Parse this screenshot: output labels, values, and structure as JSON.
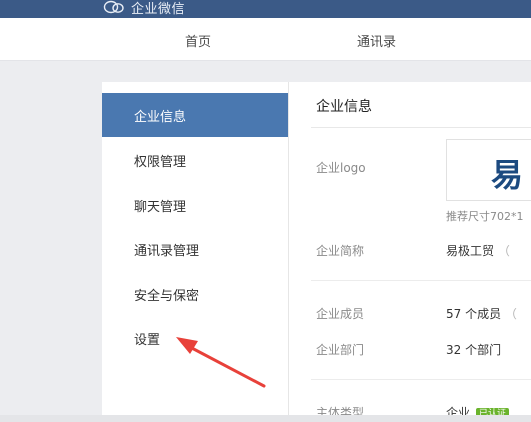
{
  "app": {
    "brand": "企业微信"
  },
  "nav": {
    "home": "首页",
    "contacts": "通讯录"
  },
  "sidebar": {
    "items": [
      {
        "label": "企业信息",
        "active": true
      },
      {
        "label": "权限管理",
        "active": false
      },
      {
        "label": "聊天管理",
        "active": false
      },
      {
        "label": "通讯录管理",
        "active": false
      },
      {
        "label": "安全与保密",
        "active": false
      },
      {
        "label": "设置",
        "active": false
      }
    ]
  },
  "content": {
    "title": "企业信息",
    "logo": {
      "label": "企业logo",
      "glyph": "易",
      "hint": "推荐尺寸702*1"
    },
    "short_name": {
      "label": "企业简称",
      "value": "易极工贸",
      "trailing": "（"
    },
    "members": {
      "label": "企业成员",
      "value": "57 个成员",
      "trailing": "（"
    },
    "departments": {
      "label": "企业部门",
      "value": "32 个部门"
    },
    "entity_type": {
      "label": "主体类型",
      "value": "企业",
      "badge": "已认证"
    }
  },
  "colors": {
    "topbar": "#3b5a87",
    "active_item": "#4a78b0",
    "verified_badge": "#6ab32c",
    "annotation_arrow": "#e8413a"
  },
  "icons": {
    "brand": "chat-bubbles-icon",
    "annotation": "red-arrow-pointer"
  }
}
